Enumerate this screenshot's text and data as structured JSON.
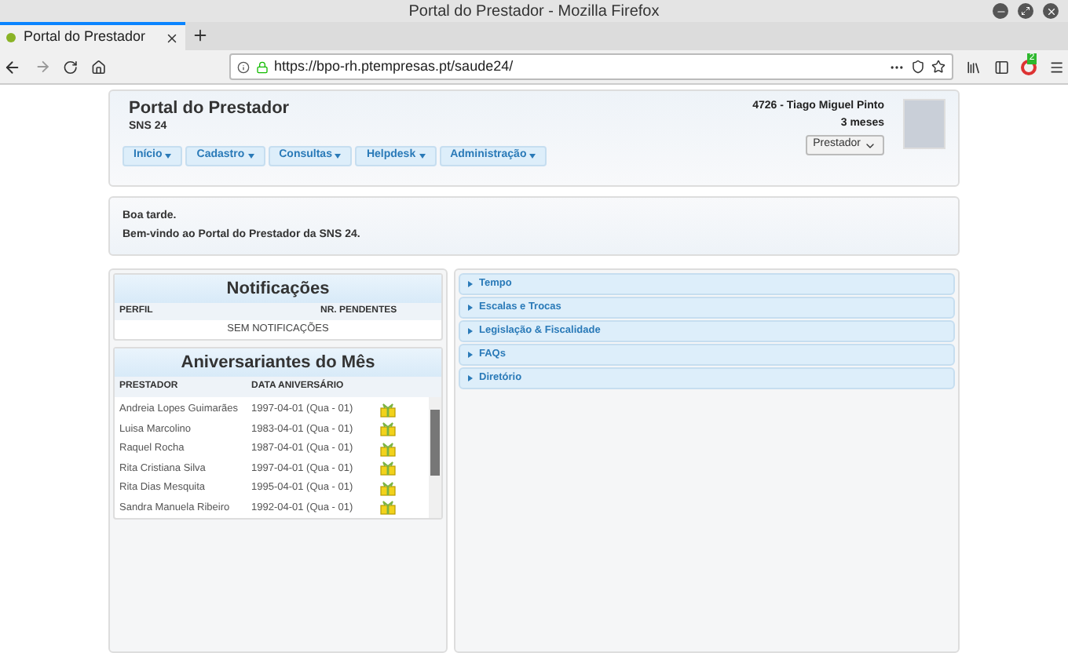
{
  "window": {
    "title": "Portal do Prestador - Mozilla Firefox"
  },
  "tabs": [
    {
      "label": "Portal do Prestador",
      "selected": true
    }
  ],
  "address_bar": {
    "url": "https://bpo-rh.ptempresas.pt/saude24/"
  },
  "extension_badge": "2",
  "header": {
    "title": "Portal do Prestador",
    "subtitle": "SNS 24",
    "user": "4726 - Tiago Miguel Pinto",
    "tenure": "3 meses",
    "role": "Prestador",
    "menu": [
      "Início",
      "Cadastro",
      "Consultas",
      "Helpdesk",
      "Administração"
    ]
  },
  "greeting": [
    "Boa tarde.",
    "Bem-vindo ao Portal do Prestador da SNS 24."
  ],
  "notifications": {
    "title": "Notificações",
    "columns": [
      "PERFIL",
      "NR. PENDENTES"
    ],
    "empty": "SEM NOTIFICAÇÕES"
  },
  "birthdays": {
    "title": "Aniversariantes do Mês",
    "columns": [
      "PRESTADOR",
      "DATA ANIVERSÁRIO"
    ],
    "rows": [
      {
        "name": "Andreia Lopes Guimarães",
        "date": "1997-04-01 (Qua - 01)"
      },
      {
        "name": "Luisa Marcolino",
        "date": "1983-04-01 (Qua - 01)"
      },
      {
        "name": "Raquel Rocha",
        "date": "1987-04-01 (Qua - 01)"
      },
      {
        "name": "Rita Cristiana Silva",
        "date": "1997-04-01 (Qua - 01)"
      },
      {
        "name": "Rita Dias Mesquita",
        "date": "1995-04-01 (Qua - 01)"
      },
      {
        "name": "Sandra Manuela Ribeiro",
        "date": "1992-04-01 (Qua - 01)"
      }
    ]
  },
  "accordion": [
    {
      "label": "Tempo",
      "expanded": false
    },
    {
      "label": "Escalas e Trocas",
      "expanded": false
    },
    {
      "label": "Legislação & Fiscalidade",
      "expanded": false
    },
    {
      "label": "FAQs",
      "expanded": false
    },
    {
      "label": "Diretório",
      "expanded": false
    }
  ]
}
